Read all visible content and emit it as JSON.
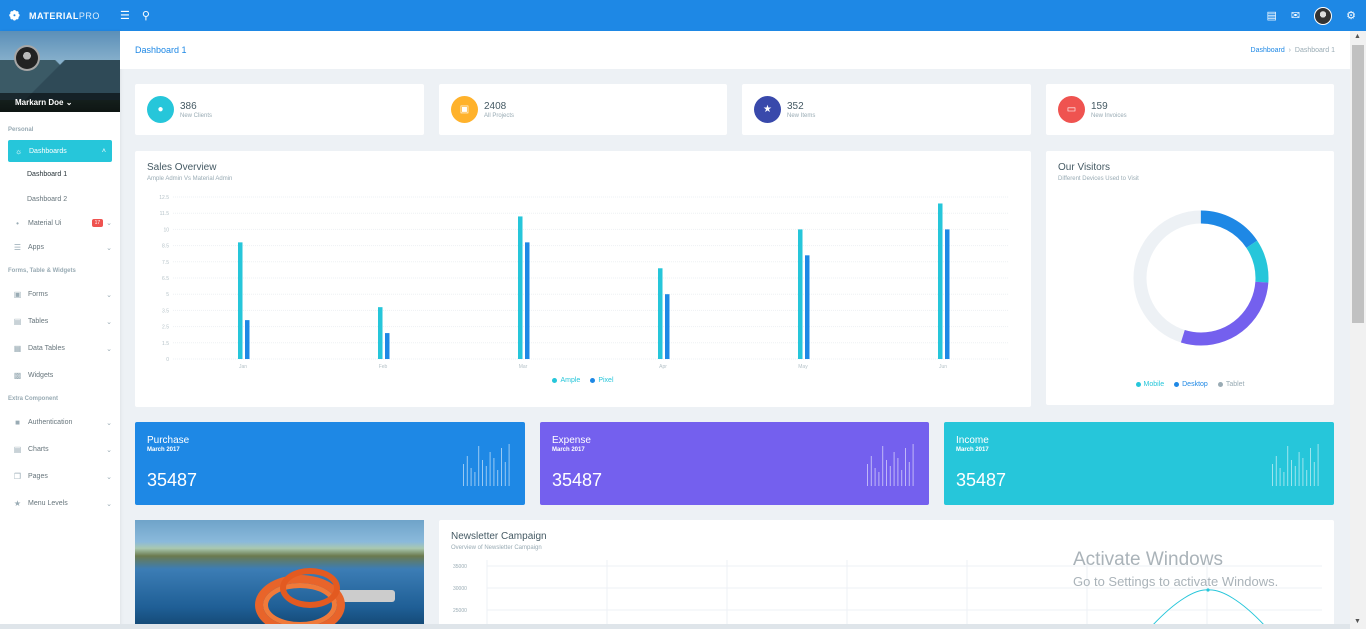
{
  "app": {
    "brand_bold": "MATERIAL",
    "brand_light": "PRO"
  },
  "sidebar": {
    "user": "Markarn Doe",
    "cap_personal": "Personal",
    "dashboards": "Dashboards",
    "sub1": "Dashboard 1",
    "sub2": "Dashboard 2",
    "material_ui": "Material Ui",
    "material_badge": "17",
    "apps": "Apps",
    "cap_forms": "Forms, Table & Widgets",
    "forms": "Forms",
    "tables": "Tables",
    "data_tables": "Data Tables",
    "widgets": "Widgets",
    "cap_extra": "Extra Component",
    "auth": "Authentication",
    "charts": "Charts",
    "pages": "Pages",
    "menu_levels": "Menu Levels"
  },
  "page": {
    "title": "Dashboard 1",
    "crumb_link": "Dashboard",
    "crumb_current": "Dashboard 1"
  },
  "stats": [
    {
      "value": "386",
      "label": "New Clients",
      "color": "#26c6da"
    },
    {
      "value": "2408",
      "label": "All Projects",
      "color": "#ffb22b"
    },
    {
      "value": "352",
      "label": "New Items",
      "color": "#3949ab"
    },
    {
      "value": "159",
      "label": "New Invoices",
      "color": "#ef5350"
    }
  ],
  "sales": {
    "title": "Sales Overview",
    "subtitle": "Ample Admin Vs Material Admin",
    "legend_a": "Ample",
    "legend_b": "Pixel"
  },
  "chart_data": {
    "type": "bar",
    "categories": [
      "Jan",
      "Feb",
      "Mar",
      "Apr",
      "May",
      "Jun"
    ],
    "yticks": [
      "0",
      "1.5",
      "2.5",
      "3.5",
      "5",
      "6.5",
      "7.5",
      "8.5",
      "10",
      "11.5",
      "12.5"
    ],
    "ylim": [
      0,
      12.5
    ],
    "series": [
      {
        "name": "Ample",
        "color": "#26c6da",
        "values": [
          9,
          4,
          11,
          7,
          10,
          12
        ]
      },
      {
        "name": "Pixel",
        "color": "#1e88e5",
        "values": [
          3,
          2,
          9,
          5,
          8,
          10
        ]
      }
    ]
  },
  "visitors": {
    "title": "Our Visitors",
    "subtitle": "Different Devices Used to Visit",
    "legend": [
      {
        "label": "Mobile",
        "color": "#26c6da"
      },
      {
        "label": "Desktop",
        "color": "#1e88e5"
      },
      {
        "label": "Tablet",
        "color": "#99abb4"
      }
    ]
  },
  "tiles": [
    {
      "title": "Purchase",
      "month": "March 2017",
      "value": "35487",
      "color": "#1e88e5"
    },
    {
      "title": "Expense",
      "month": "March 2017",
      "value": "35487",
      "color": "#7460ee"
    },
    {
      "title": "Income",
      "month": "March 2017",
      "value": "35487",
      "color": "#26c6da"
    }
  ],
  "newsletter": {
    "title": "Newsletter Campaign",
    "subtitle": "Overview of Newsletter Campaign",
    "yticks": [
      "35000",
      "30000",
      "25000"
    ]
  },
  "windows": {
    "line1": "Activate Windows",
    "line2": "Go to Settings to activate Windows."
  }
}
